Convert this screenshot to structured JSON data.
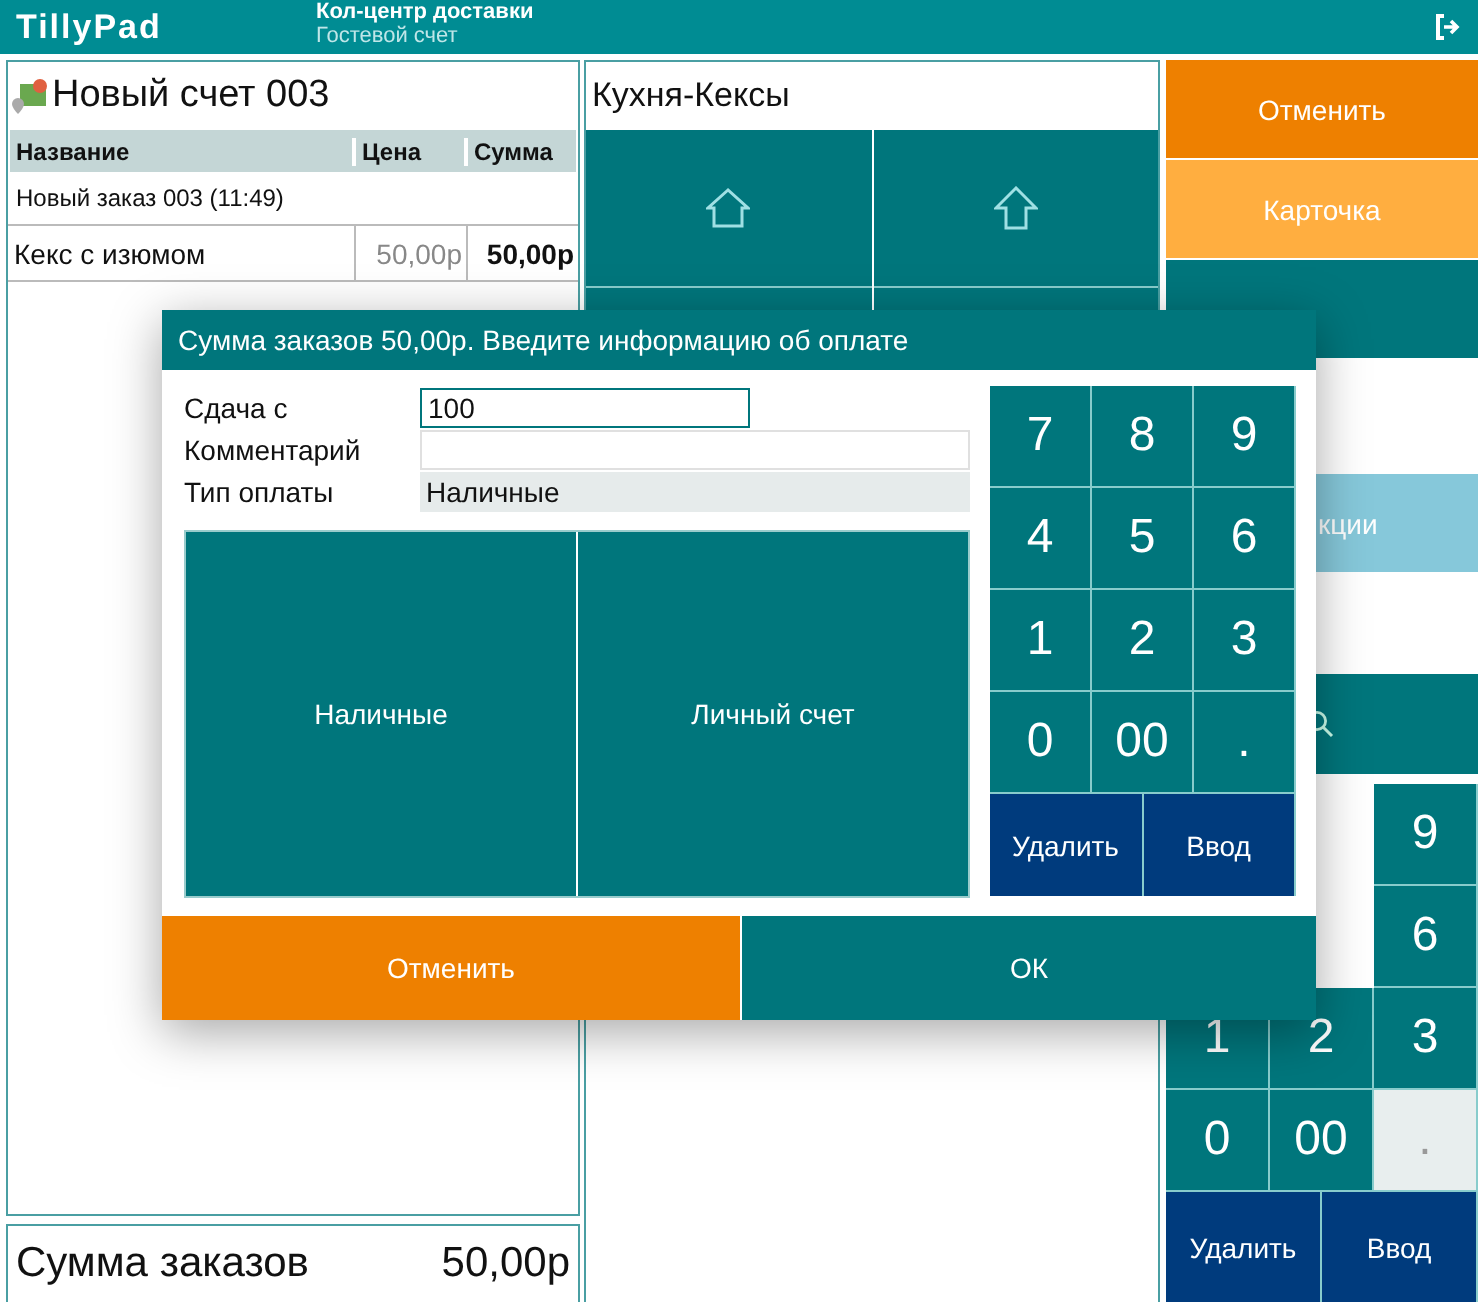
{
  "header": {
    "logo": "TillyPad",
    "title": "Кол-центр доставки",
    "subtitle": "Гостевой счет"
  },
  "bill": {
    "title": "Новый счет 003",
    "columns": [
      "Название",
      "Цена",
      "Сумма"
    ],
    "group": "Новый заказ 003 (11:49)",
    "rows": [
      {
        "name": "Кекс с изюмом",
        "price": "50,00р",
        "sum": "50,00р"
      }
    ],
    "total_label": "Сумма заказов",
    "total": "50,00р"
  },
  "menu": {
    "title": "Кухня-Кексы",
    "tiles": [
      {
        "kind": "home"
      },
      {
        "kind": "up"
      }
    ]
  },
  "actions": [
    {
      "label": "Отменить",
      "kind": "cancel"
    },
    {
      "label": "Карточка",
      "kind": "card"
    },
    {
      "kind": "save"
    },
    {
      "label": "кции",
      "kind": "promo"
    }
  ],
  "keypad": {
    "keys": [
      {
        "label": "9",
        "disabled": false
      },
      {
        "label": "6",
        "disabled": false
      },
      {
        "label": "1",
        "disabled": false
      },
      {
        "label": "2",
        "disabled": false
      },
      {
        "label": "3",
        "disabled": false
      },
      {
        "label": "0",
        "disabled": false
      },
      {
        "label": "00",
        "disabled": false
      },
      {
        "label": ".",
        "disabled": true
      }
    ],
    "delete": "Удалить",
    "enter": "Ввод"
  },
  "dialog": {
    "title": "Сумма заказов 50,00р. Введите информацию об оплате",
    "fields": [
      {
        "label": "Сдача с",
        "value": "100",
        "kind": "input"
      },
      {
        "label": "Комментарий",
        "kind": "input"
      },
      {
        "label": "Тип оплаты",
        "value": "Наличные",
        "kind": "readonly"
      }
    ],
    "payment_types": [
      "Наличные",
      "Личный счет"
    ],
    "keys": [
      "7",
      "8",
      "9",
      "4",
      "5",
      "6",
      "1",
      "2",
      "3",
      "0",
      "00",
      "."
    ],
    "delete": "Удалить",
    "enter": "Ввод",
    "cancel": "Отменить",
    "ok": "ОК"
  }
}
